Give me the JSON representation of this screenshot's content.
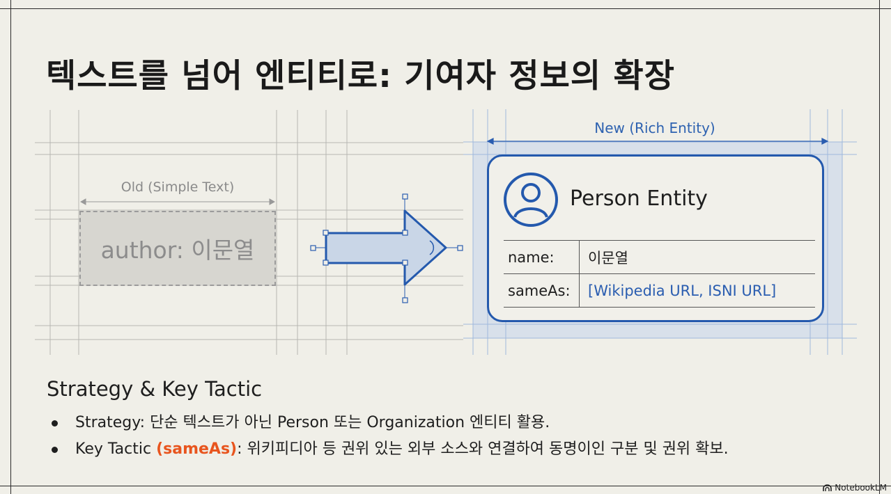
{
  "title": "텍스트를 넘어 엔티티로: 기여자 정보의 확장",
  "old": {
    "label": "Old (Simple Text)",
    "content": "author: 이문열"
  },
  "new": {
    "label": "New (Rich Entity)",
    "entity_title": "Person Entity",
    "properties": [
      {
        "key": "name:",
        "value": "이문열"
      },
      {
        "key": "sameAs:",
        "value": "[Wikipedia URL, ISNI URL]"
      }
    ]
  },
  "section": {
    "heading": "Strategy & Key Tactic",
    "bullets": [
      {
        "text": "Strategy: 단순 텍스트가 아닌 Person 또는 Organization 엔티티 활용."
      },
      {
        "pre": "Key Tactic ",
        "accent": "(sameAs)",
        "post": ": 위키피디아 등 권위 있는 외부 소스와 연결하여 동명이인 구분 및 권위 확보."
      }
    ]
  },
  "watermark": "NotebookLM",
  "icons": [
    "person-avatar-icon",
    "right-arrow-icon",
    "notebooklm-logo-icon"
  ],
  "colors": {
    "accent_blue": "#2459ad",
    "accent_orange": "#e8551e",
    "background": "#f0efe8"
  }
}
